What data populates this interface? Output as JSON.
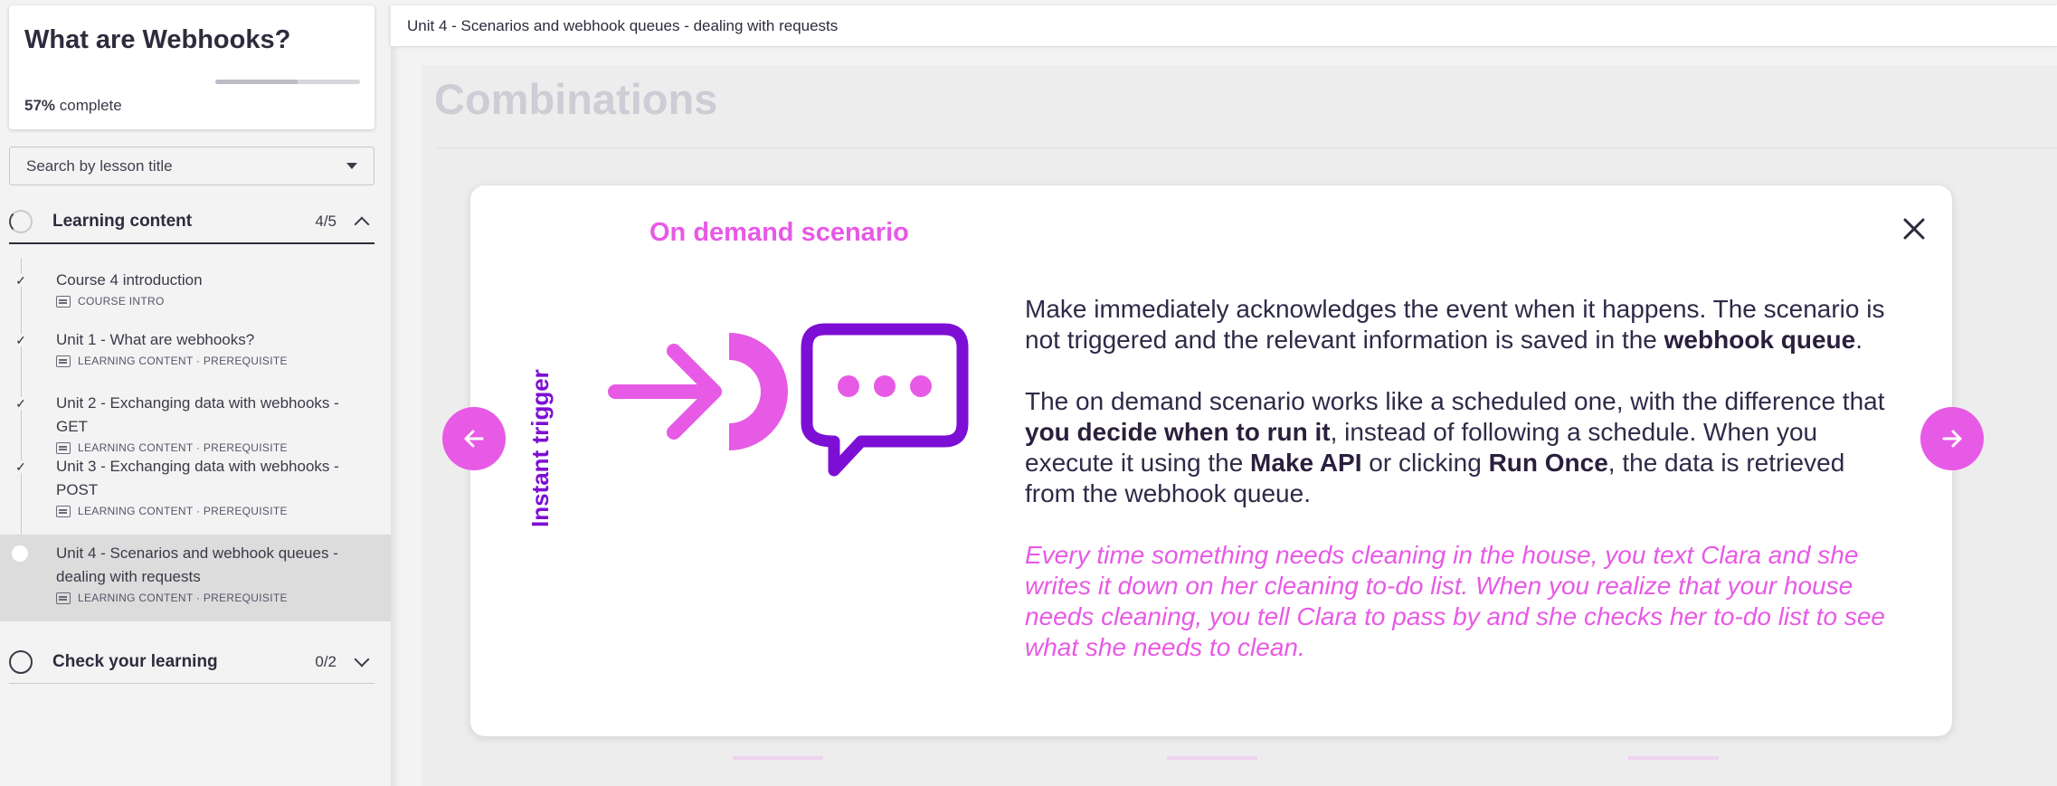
{
  "course": {
    "title": "What are Webhooks?",
    "progress_percent": "57%",
    "progress_suffix": " complete",
    "progress_fraction": 0.57
  },
  "search": {
    "label": "Search by lesson title"
  },
  "sections": [
    {
      "name": "Learning content",
      "count": "4/5",
      "expanded": true
    },
    {
      "name": "Check your learning",
      "count": "0/2",
      "expanded": false
    }
  ],
  "lessons": [
    {
      "title": "Course 4 introduction",
      "meta": "COURSE INTRO",
      "done": true
    },
    {
      "title": "Unit 1 - What are webhooks?",
      "meta": "LEARNING CONTENT · PREREQUISITE",
      "done": true
    },
    {
      "title": "Unit 2 - Exchanging data with webhooks - GET",
      "meta": "LEARNING CONTENT · PREREQUISITE",
      "done": true
    },
    {
      "title": "Unit 3 - Exchanging data with webhooks - POST",
      "meta": "LEARNING CONTENT · PREREQUISITE",
      "done": true
    },
    {
      "title": "Unit 4 - Scenarios and webhook queues - dealing with requests",
      "meta": "LEARNING CONTENT · PREREQUISITE",
      "done": false,
      "active": true
    }
  ],
  "topbar": {
    "title": "Unit 4 - Scenarios and webhook queues - dealing with requests"
  },
  "page": {
    "title": "Combinations"
  },
  "modal": {
    "heading": "On demand scenario",
    "side_label": "Instant trigger",
    "p1_a": "Make immediately acknowledges the event when it happens. The scenario is not triggered and the relevant information is saved in the ",
    "p1_b": "webhook queue",
    "p1_c": ".",
    "p2_a": "The on demand scenario works like a scheduled one, with the difference that ",
    "p2_b": "you decide when to run it",
    "p2_c": ", instead of following a schedule. When you execute it using the ",
    "p2_d": "Make API",
    "p2_e": " or clicking ",
    "p2_f": "Run Once",
    "p2_g": ", the data is retrieved from the webhook queue.",
    "p3": "Every time something needs cleaning in the house, you text Clara and she writes it down on her cleaning to-do list. When you realize that your house needs cleaning, you tell Clara to pass by and she checks her to-do list to see what she needs to clean."
  },
  "icons": {
    "close": "close-icon",
    "prev": "arrow-left-icon",
    "next": "arrow-right-icon",
    "trigger": "instant-trigger-icon",
    "chat": "chat-bubble-icon"
  },
  "colors": {
    "accent_pink": "#e75ae5",
    "accent_purple": "#7d0fd4"
  }
}
